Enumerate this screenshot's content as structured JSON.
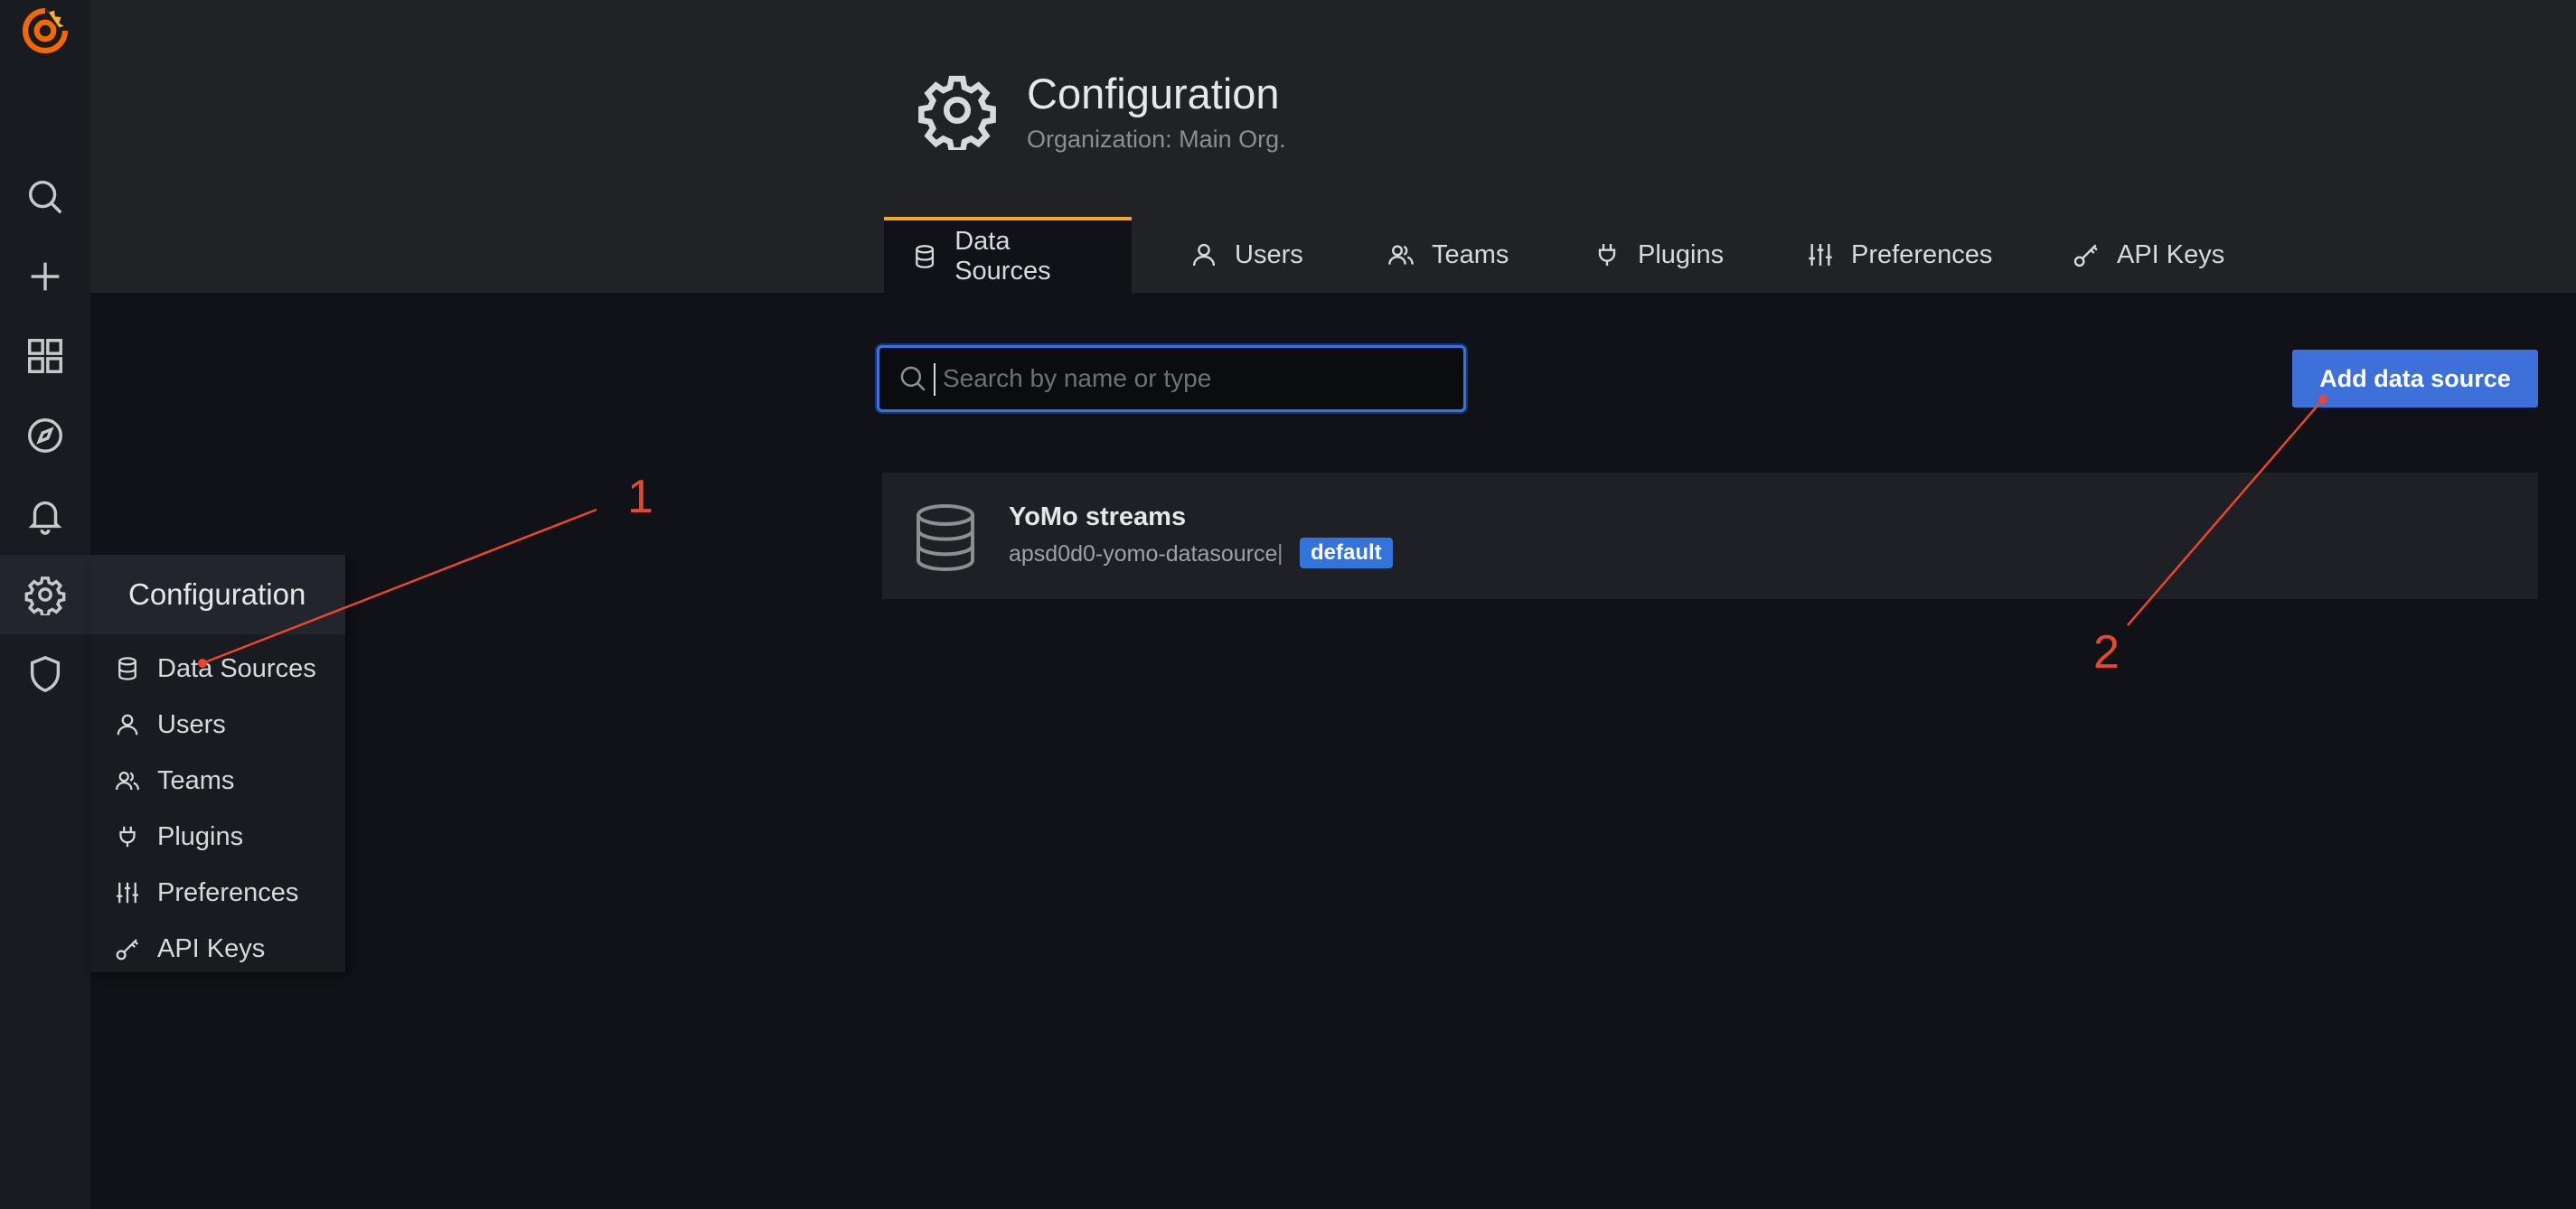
{
  "sidebar": {
    "icons": [
      "grafana-logo",
      "search-icon",
      "plus-icon",
      "dashboards-icon",
      "explore-icon",
      "bell-icon",
      "gear-icon",
      "shield-icon"
    ]
  },
  "header": {
    "title": "Configuration",
    "subtitle": "Organization: Main Org."
  },
  "tabs": [
    {
      "label": "Data Sources",
      "icon": "database-icon",
      "active": true
    },
    {
      "label": "Users",
      "icon": "user-icon"
    },
    {
      "label": "Teams",
      "icon": "users-icon"
    },
    {
      "label": "Plugins",
      "icon": "plug-icon"
    },
    {
      "label": "Preferences",
      "icon": "sliders-icon"
    },
    {
      "label": "API Keys",
      "icon": "key-icon"
    }
  ],
  "search": {
    "placeholder": "Search by name or type",
    "value": ""
  },
  "add_button_label": "Add data source",
  "datasource": {
    "name": "YoMo streams",
    "type": "apsd0d0-yomo-datasource",
    "separator": "|",
    "badge": "default"
  },
  "flyout": {
    "title": "Configuration",
    "items": [
      {
        "label": "Data Sources",
        "icon": "database-icon"
      },
      {
        "label": "Users",
        "icon": "user-icon"
      },
      {
        "label": "Teams",
        "icon": "users-icon"
      },
      {
        "label": "Plugins",
        "icon": "plug-icon"
      },
      {
        "label": "Preferences",
        "icon": "sliders-icon"
      },
      {
        "label": "API Keys",
        "icon": "key-icon"
      }
    ]
  },
  "annotations": {
    "label_1": "1",
    "label_2": "2",
    "color": "#e8462d"
  },
  "colors": {
    "accent_blue": "#3d71d9",
    "tab_active_border": "#f5a623",
    "logo": "#f46800"
  }
}
